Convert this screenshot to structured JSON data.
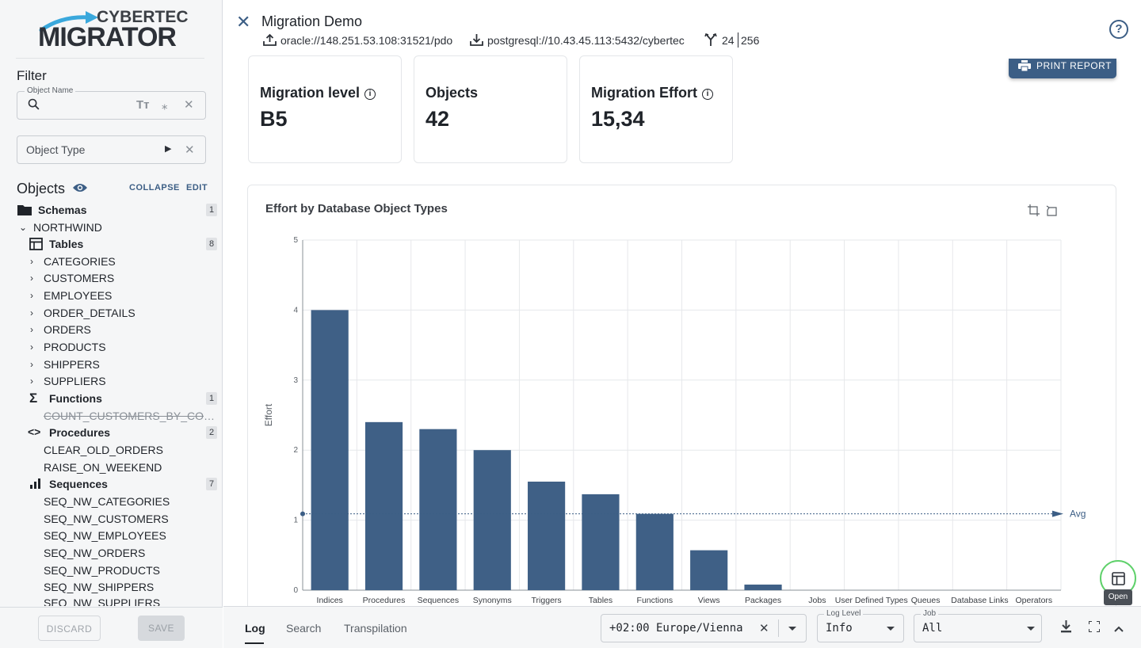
{
  "colors": {
    "accent": "#3c5e85",
    "bar": "#3f6086",
    "fab_ring": "#5fd16b"
  },
  "logo": {
    "top": "CYBERTEC",
    "main": "MIGRATOR"
  },
  "sidebar": {
    "filter_title": "Filter",
    "object_name": {
      "legend": "Object Name",
      "value": ""
    },
    "object_type": {
      "value": "Object Type"
    },
    "objects_title": "Objects",
    "collapse_label": "COLLAPSE",
    "edit_label": "EDIT",
    "tree": {
      "schemas": {
        "label": "Schemas",
        "count": "1"
      },
      "schema_name": "NORTHWIND",
      "tables": {
        "label": "Tables",
        "count": "8",
        "items": [
          "CATEGORIES",
          "CUSTOMERS",
          "EMPLOYEES",
          "ORDER_DETAILS",
          "ORDERS",
          "PRODUCTS",
          "SHIPPERS",
          "SUPPLIERS"
        ]
      },
      "functions": {
        "label": "Functions",
        "count": "1",
        "items": [
          "COUNT_CUSTOMERS_BY_COUNTRY"
        ]
      },
      "procedures": {
        "label": "Procedures",
        "count": "2",
        "items": [
          "CLEAR_OLD_ORDERS",
          "RAISE_ON_WEEKEND"
        ]
      },
      "sequences": {
        "label": "Sequences",
        "count": "7",
        "items": [
          "SEQ_NW_CATEGORIES",
          "SEQ_NW_CUSTOMERS",
          "SEQ_NW_EMPLOYEES",
          "SEQ_NW_ORDERS",
          "SEQ_NW_PRODUCTS",
          "SEQ_NW_SHIPPERS",
          "SEQ_NW_SUPPLIERS"
        ]
      }
    },
    "discard_label": "DISCARD",
    "save_label": "SAVE"
  },
  "header": {
    "title": "Migration Demo",
    "source": "oracle://148.251.53.108:31521/pdo",
    "target": "postgresql://10.43.45.113:5432/cybertec",
    "count_a": "24",
    "count_b": "256",
    "help": "?"
  },
  "cards": [
    {
      "label": "Migration level",
      "value": "B5",
      "info": true
    },
    {
      "label": "Objects",
      "value": "42",
      "info": false
    },
    {
      "label": "Migration Effort",
      "value": "15,34",
      "info": true
    }
  ],
  "print_label": "PRINT REPORT",
  "chart_data": {
    "type": "bar",
    "title": "Effort by Database Object Types",
    "xlabel": "",
    "ylabel": "Effort",
    "ylim": [
      0,
      5
    ],
    "yticks": [
      0,
      1,
      2,
      3,
      4,
      5
    ],
    "categories": [
      "Indices",
      "Procedures",
      "Sequences",
      "Synonyms",
      "Triggers",
      "Tables",
      "Functions",
      "Views",
      "Packages",
      "Jobs",
      "User Defined Types",
      "Queues",
      "Database Links",
      "Operators"
    ],
    "values": [
      4.0,
      2.4,
      2.3,
      2.0,
      1.55,
      1.37,
      1.09,
      0.57,
      0.08,
      0,
      0,
      0,
      0,
      0
    ],
    "avg_line": {
      "label": "Avg",
      "value": 1.09
    },
    "grid": true
  },
  "bottom": {
    "tabs": [
      "Log",
      "Search",
      "Transpilation"
    ],
    "timezone": "+02:00 Europe/Vienna",
    "log_level": {
      "legend": "Log Level",
      "value": "Info"
    },
    "job": {
      "legend": "Job",
      "value": "All"
    },
    "open_label": "Open"
  }
}
